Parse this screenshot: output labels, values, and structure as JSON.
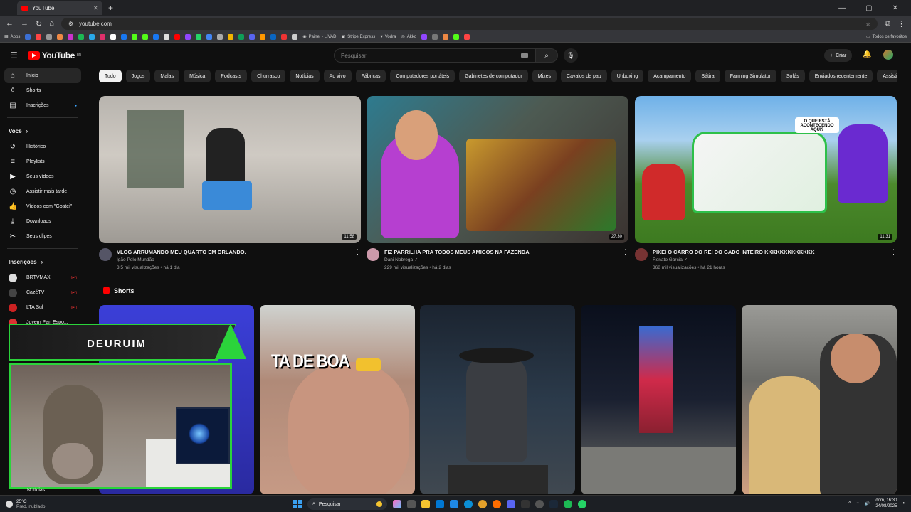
{
  "browser": {
    "tab_title": "YouTube",
    "url": "youtube.com",
    "bookmarks": [
      "Apps",
      "Painel - LIVAD",
      "Stripe Express",
      "Vodra",
      "Akko",
      "Todos os favoritos"
    ]
  },
  "header": {
    "logo_text": "YouTube",
    "logo_region": "BR",
    "search_placeholder": "Pesquisar",
    "create_label": "Criar"
  },
  "sidebar": {
    "main": [
      {
        "label": "Início",
        "icon": "home-icon"
      },
      {
        "label": "Shorts",
        "icon": "shorts-icon"
      },
      {
        "label": "Inscrições",
        "icon": "subscriptions-icon"
      }
    ],
    "you_heading": "Você",
    "you": [
      {
        "label": "Histórico",
        "icon": "history-icon"
      },
      {
        "label": "Playlists",
        "icon": "playlist-icon"
      },
      {
        "label": "Seus vídeos",
        "icon": "video-icon"
      },
      {
        "label": "Assistir mais tarde",
        "icon": "clock-icon"
      },
      {
        "label": "Vídeos com \"Gostei\"",
        "icon": "like-icon"
      },
      {
        "label": "Downloads",
        "icon": "download-icon"
      },
      {
        "label": "Seus clipes",
        "icon": "scissors-icon"
      }
    ],
    "subs_heading": "Inscrições",
    "subs": [
      {
        "label": "BRTVMAX"
      },
      {
        "label": "CazéTV"
      },
      {
        "label": "LTA Sul"
      },
      {
        "label": "Jovem Pan Espo..."
      }
    ],
    "bottom_item": "Notícias"
  },
  "chips": [
    "Tudo",
    "Jogos",
    "Malas",
    "Música",
    "Podcasts",
    "Churrasco",
    "Notícias",
    "Ao vivo",
    "Fábricas",
    "Computadores portáteis",
    "Gabinetes de computador",
    "Mixes",
    "Cavalos de pau",
    "Unboxing",
    "Acampamento",
    "Sátira",
    "Farming Simulator",
    "Sofás",
    "Enviados recentemente",
    "Assistido"
  ],
  "videos": [
    {
      "title": "VLOG ARRUMANDO MEU QUARTO EM ORLANDO.",
      "channel": "Igão Pelo Mundão",
      "stats": "3,5 mil visualizações • há 1 dia",
      "duration": "11:58"
    },
    {
      "title": "FIZ PARRILHA PRA TODOS MEUS AMIGOS NA FAZENDA",
      "channel": "Dani Nobrega",
      "stats": "229 mil visualizações • há 2 dias",
      "duration": "27:30"
    },
    {
      "title": "PIXEI O CARRO DO REI DO GADO INTEIRO KKKKKKKKKKKKK",
      "channel": "Renato Garcia",
      "stats": "368 mil visualizações • há 21 horas",
      "duration": "11:31"
    }
  ],
  "shorts": {
    "heading": "Shorts",
    "second_caption": "TA DE BOA"
  },
  "overlay": {
    "banner_text": "DEURUIM"
  },
  "taskbar": {
    "temp": "25°C",
    "weather": "Pred. nublado",
    "search": "Pesquisar",
    "time": "dom, 16:30",
    "date": "24/08/2025"
  }
}
